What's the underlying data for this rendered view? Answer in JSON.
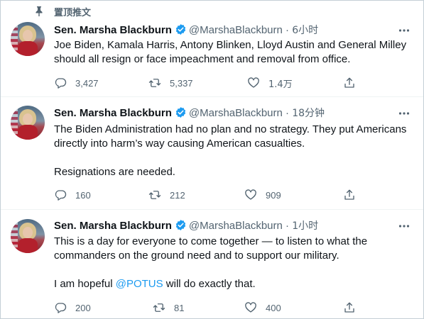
{
  "pinned": {
    "label": "置顶推文"
  },
  "tweets": [
    {
      "name": "Sen. Marsha Blackburn",
      "handle": "@MarshaBlackburn",
      "dot": "·",
      "time": "6小时",
      "paragraphs": [
        "Joe Biden, Kamala Harris, Antony Blinken, Lloyd Austin and General Milley should all resign or face impeachment and removal from office."
      ],
      "replies": "3,427",
      "retweets": "5,337",
      "likes": "1.4万"
    },
    {
      "name": "Sen. Marsha Blackburn",
      "handle": "@MarshaBlackburn",
      "dot": "·",
      "time": "18分钟",
      "paragraphs": [
        "The Biden Administration had no plan and no strategy. They put Americans directly into harm’s way causing American casualties.",
        "Resignations are needed."
      ],
      "replies": "160",
      "retweets": "212",
      "likes": "909"
    },
    {
      "name": "Sen. Marsha Blackburn",
      "handle": "@MarshaBlackburn",
      "dot": "·",
      "time": "1小时",
      "paragraphs": [
        "This is a day for everyone to come together — to listen to what the commanders on the ground need and to support our military."
      ],
      "last_paragraph": {
        "before": "I am hopeful ",
        "mention": "@POTUS",
        "after": " will do exactly that."
      },
      "replies": "200",
      "retweets": "81",
      "likes": "400"
    }
  ],
  "icons": {
    "pin": "pin-icon",
    "verified": "verified-badge-icon",
    "more": "more-options-icon",
    "reply": "reply-icon",
    "retweet": "retweet-icon",
    "like": "like-icon",
    "share": "share-icon"
  },
  "colors": {
    "accent": "#1d9bf0",
    "secondary_text": "#536471",
    "divider": "#eff3f4"
  }
}
